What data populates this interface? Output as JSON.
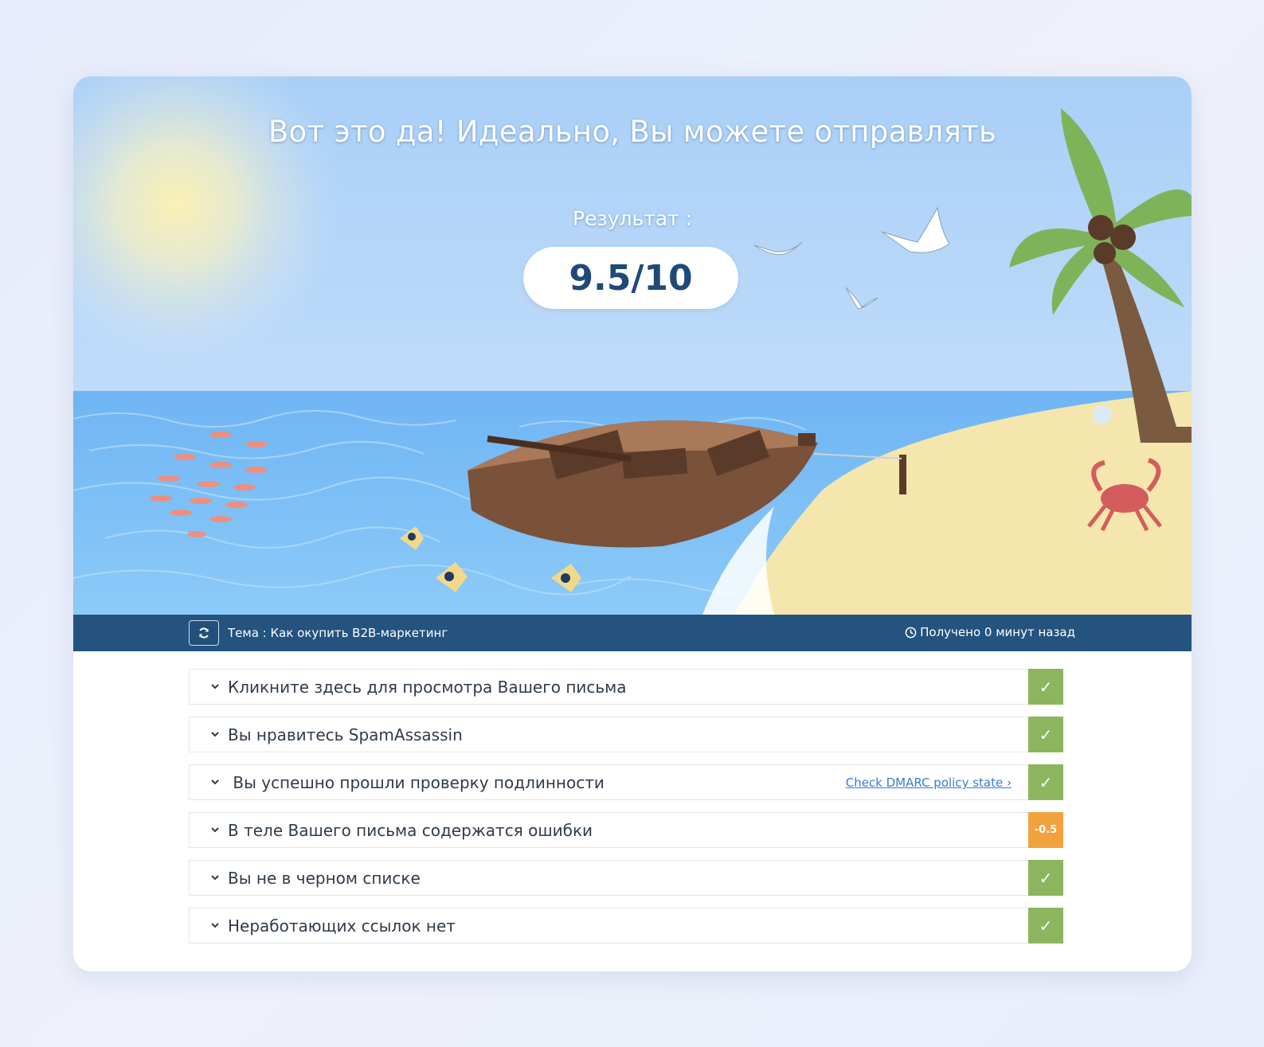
{
  "hero": {
    "headline": "Вот это да! Идеально, Вы можете отправлять",
    "result_label": "Результат :",
    "score": "9.5/10"
  },
  "infobar": {
    "topic": "Тема : Как окупить B2B-маркетинг",
    "received": "Получено 0 минут назад"
  },
  "checks": [
    {
      "label": "Кликните здесь для просмотра Вашего письма",
      "status": "✓",
      "status_type": "ok"
    },
    {
      "label": "Вы нравитесь SpamAssassin",
      "status": "✓",
      "status_type": "ok"
    },
    {
      "label": " Вы успешно прошли проверку подлинности",
      "link": "Check DMARC policy state ›",
      "status": "✓",
      "status_type": "ok"
    },
    {
      "label": "В теле Вашего письма содержатся ошибки",
      "status": "-0.5",
      "status_type": "warn"
    },
    {
      "label": "Вы не в черном списке",
      "status": "✓",
      "status_type": "ok"
    },
    {
      "label": "Неработающих ссылок нет",
      "status": "✓",
      "status_type": "ok"
    }
  ],
  "colors": {
    "infobar": "#23537e",
    "ok": "#8db55d",
    "warn": "#f0a33c",
    "score_text": "#1f4a78"
  }
}
